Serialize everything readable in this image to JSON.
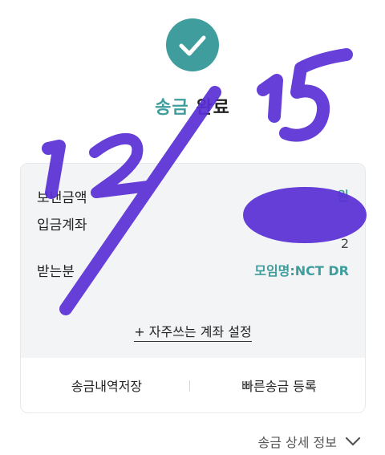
{
  "header": {
    "title_part1": "송금",
    "title_part2": "완료"
  },
  "summary": {
    "rows": [
      {
        "label": "보낸금액",
        "value": "원"
      },
      {
        "label": "입금계좌",
        "value": "2"
      },
      {
        "label": "받는분",
        "value": "모임명:NCT DR"
      }
    ],
    "frequent_account_link": "+ 자주쓰는 계좌 설정"
  },
  "actions": {
    "save_history": "송금내역저장",
    "quick_transfer": "빠른송금 등록"
  },
  "footer": {
    "details_label": "송금 상세 정보"
  },
  "overlay": {
    "handwriting": "12/15"
  },
  "colors": {
    "accent": "#3f9e9d",
    "ink": "#5a2fd6",
    "card_bg": "#f3f4f6"
  },
  "icons": {
    "success": "check-circle-icon",
    "details": "chevron-down-icon"
  }
}
